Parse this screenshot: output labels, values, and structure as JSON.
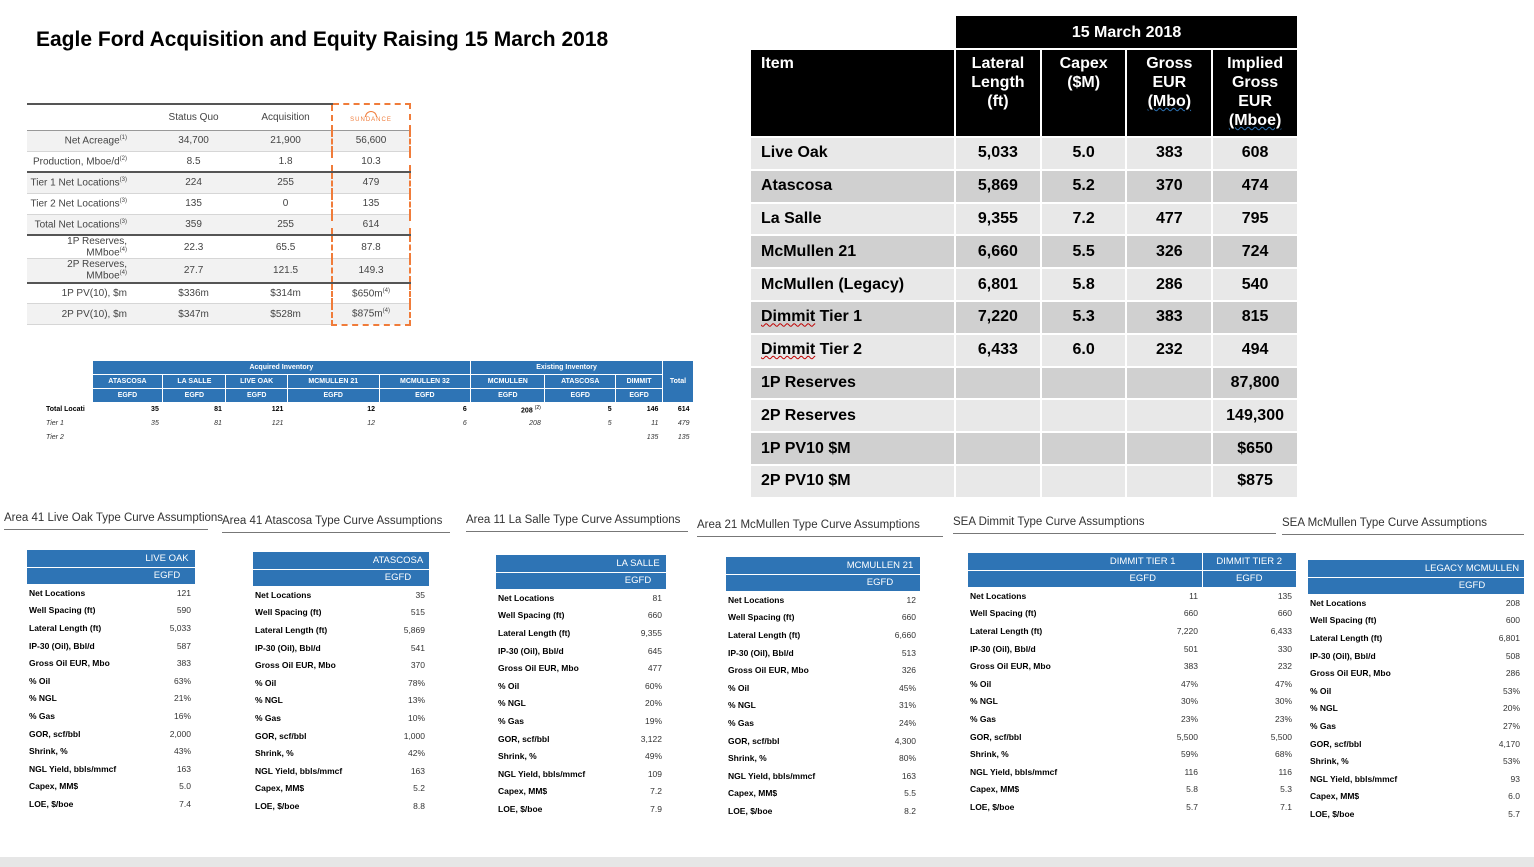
{
  "title": "Eagle Ford Acquisition and  Equity Raising 15 March 2018",
  "comparison": {
    "headers": [
      "Status Quo",
      "Acquisition"
    ],
    "logo_text": "SUNDANCE",
    "rows": [
      {
        "label": "Net Acreage",
        "sup": "(1)",
        "sq": "34,700",
        "acq": "21,900",
        "sd": "56,600",
        "sd_sup": ""
      },
      {
        "label": "Production, Mboe/d",
        "sup": "(2)",
        "sq": "8.5",
        "acq": "1.8",
        "sd": "10.3",
        "sd_sup": ""
      },
      {
        "label": "Tier 1 Net Locations",
        "sup": "(3)",
        "sq": "224",
        "acq": "255",
        "sd": "479",
        "sd_sup": ""
      },
      {
        "label": "Tier 2 Net Locations",
        "sup": "(3)",
        "sq": "135",
        "acq": "0",
        "sd": "135",
        "sd_sup": ""
      },
      {
        "label": "Total Net Locations",
        "sup": "(3)",
        "sq": "359",
        "acq": "255",
        "sd": "614",
        "sd_sup": ""
      },
      {
        "label": "1P Reserves, MMboe",
        "sup": "(4)",
        "sq": "22.3",
        "acq": "65.5",
        "sd": "87.8",
        "sd_sup": ""
      },
      {
        "label": "2P Reserves, MMboe",
        "sup": "(4)",
        "sq": "27.7",
        "acq": "121.5",
        "sd": "149.3",
        "sd_sup": ""
      },
      {
        "label": "1P PV(10), $m",
        "sup": "",
        "sq": "$336m",
        "acq": "$314m",
        "sd": "$650m",
        "sd_sup": "(4)"
      },
      {
        "label": "2P PV(10), $m",
        "sup": "",
        "sq": "$347m",
        "acq": "$528m",
        "sd": "$875m",
        "sd_sup": "(4)"
      }
    ]
  },
  "inventory": {
    "group_acquired": "Acquired Inventory",
    "group_existing": "Existing Inventory",
    "total_header": "Total",
    "columns": [
      "ATASCOSA",
      "LA SALLE",
      "LIVE OAK",
      "MCMULLEN 21",
      "MCMULLEN 32",
      "MCMULLEN",
      "ATASCOSA",
      "DIMMIT"
    ],
    "sub": "EGFD",
    "rows": [
      {
        "label": "Total Locati",
        "values": [
          "35",
          "81",
          "121",
          "12",
          "6",
          "208",
          "5",
          "146"
        ],
        "total": "614",
        "note": "(2)"
      },
      {
        "label": "Tier 1",
        "values": [
          "35",
          "81",
          "121",
          "12",
          "6",
          "208",
          "5",
          "11"
        ],
        "total": "479",
        "note": ""
      },
      {
        "label": "Tier 2",
        "values": [
          "",
          "",
          "",
          "",
          "",
          "",
          "",
          "135"
        ],
        "total": "135",
        "note": ""
      }
    ]
  },
  "main_table": {
    "date_header": "15 March 2018",
    "col_item": "Item",
    "col_lateral": [
      "Lateral",
      "Length",
      "(ft)"
    ],
    "col_capex": [
      "Capex",
      "($M)"
    ],
    "col_gross": [
      "Gross",
      "EUR",
      "(Mbo)"
    ],
    "col_implied": [
      "Implied",
      "Gross",
      "EUR",
      "(Mboe)"
    ],
    "rows": [
      {
        "item": "Live Oak",
        "lateral": "5,033",
        "capex": "5.0",
        "gross": "383",
        "implied": "608"
      },
      {
        "item": "Atascosa",
        "lateral": "5,869",
        "capex": "5.2",
        "gross": "370",
        "implied": "474"
      },
      {
        "item": "La Salle",
        "lateral": "9,355",
        "capex": "7.2",
        "gross": "477",
        "implied": "795"
      },
      {
        "item": "McMullen 21",
        "lateral": "6,660",
        "capex": "5.5",
        "gross": "326",
        "implied": "724"
      },
      {
        "item": "McMullen (Legacy)",
        "lateral": "6,801",
        "capex": "5.8",
        "gross": "286",
        "implied": "540"
      },
      {
        "item": "Dimmit Tier 1",
        "lateral": "7,220",
        "capex": "5.3",
        "gross": "383",
        "implied": "815"
      },
      {
        "item": "Dimmit Tier 2",
        "lateral": "6,433",
        "capex": "6.0",
        "gross": "232",
        "implied": "494"
      },
      {
        "item": "1P Reserves",
        "lateral": "",
        "capex": "",
        "gross": "",
        "implied": "87,800"
      },
      {
        "item": "2P Reserves",
        "lateral": "",
        "capex": "",
        "gross": "",
        "implied": "149,300"
      },
      {
        "item": "1P PV10 $M",
        "lateral": "",
        "capex": "",
        "gross": "",
        "implied": "$650"
      },
      {
        "item": "2P PV10 $M",
        "lateral": "",
        "capex": "",
        "gross": "",
        "implied": "$875"
      }
    ]
  },
  "type_curves": {
    "labels": [
      "Net Locations",
      "Well Spacing (ft)",
      "Lateral Length (ft)",
      "IP-30 (Oil), Bbl/d",
      "Gross Oil EUR, Mbo",
      "% Oil",
      "% NGL",
      "% Gas",
      "GOR, scf/bbl",
      "Shrink, %",
      "NGL Yield, bbls/mmcf",
      "Capex, MM$",
      "LOE, $/boe"
    ],
    "sub": "EGFD",
    "panels": [
      {
        "title": "Area 41 Live Oak Type Curve Assumptions",
        "cols": [
          {
            "name": "LIVE OAK",
            "values": [
              "121",
              "590",
              "5,033",
              "587",
              "383",
              "63%",
              "21%",
              "16%",
              "2,000",
              "43%",
              "163",
              "5.0",
              "7.4"
            ]
          }
        ]
      },
      {
        "title": "Area 41 Atascosa Type Curve Assumptions",
        "cols": [
          {
            "name": "ATASCOSA",
            "values": [
              "35",
              "515",
              "5,869",
              "541",
              "370",
              "78%",
              "13%",
              "10%",
              "1,000",
              "42%",
              "163",
              "5.2",
              "8.8"
            ]
          }
        ]
      },
      {
        "title": "Area 11 La Salle Type Curve Assumptions",
        "cols": [
          {
            "name": "LA SALLE",
            "values": [
              "81",
              "660",
              "9,355",
              "645",
              "477",
              "60%",
              "20%",
              "19%",
              "3,122",
              "49%",
              "109",
              "7.2",
              "7.9"
            ]
          }
        ]
      },
      {
        "title": "Area 21 McMullen Type Curve Assumptions",
        "cols": [
          {
            "name": "MCMULLEN 21",
            "values": [
              "12",
              "660",
              "6,660",
              "513",
              "326",
              "45%",
              "31%",
              "24%",
              "4,300",
              "80%",
              "163",
              "5.5",
              "8.2"
            ]
          }
        ]
      },
      {
        "title": "SEA Dimmit Type Curve Assumptions",
        "cols": [
          {
            "name": "DIMMIT TIER 1",
            "values": [
              "11",
              "660",
              "7,220",
              "501",
              "383",
              "47%",
              "30%",
              "23%",
              "5,500",
              "59%",
              "116",
              "5.8",
              "5.7"
            ]
          },
          {
            "name": "DIMMIT TIER 2",
            "values": [
              "135",
              "660",
              "6,433",
              "330",
              "232",
              "47%",
              "30%",
              "23%",
              "5,500",
              "68%",
              "116",
              "5.3",
              "7.1"
            ]
          }
        ]
      },
      {
        "title": "SEA McMullen Type Curve Assumptions",
        "cols": [
          {
            "name": "LEGACY MCMULLEN",
            "values": [
              "208",
              "600",
              "6,801",
              "508",
              "286",
              "53%",
              "20%",
              "27%",
              "4,170",
              "53%",
              "93",
              "6.0",
              "5.7"
            ]
          }
        ]
      }
    ]
  }
}
